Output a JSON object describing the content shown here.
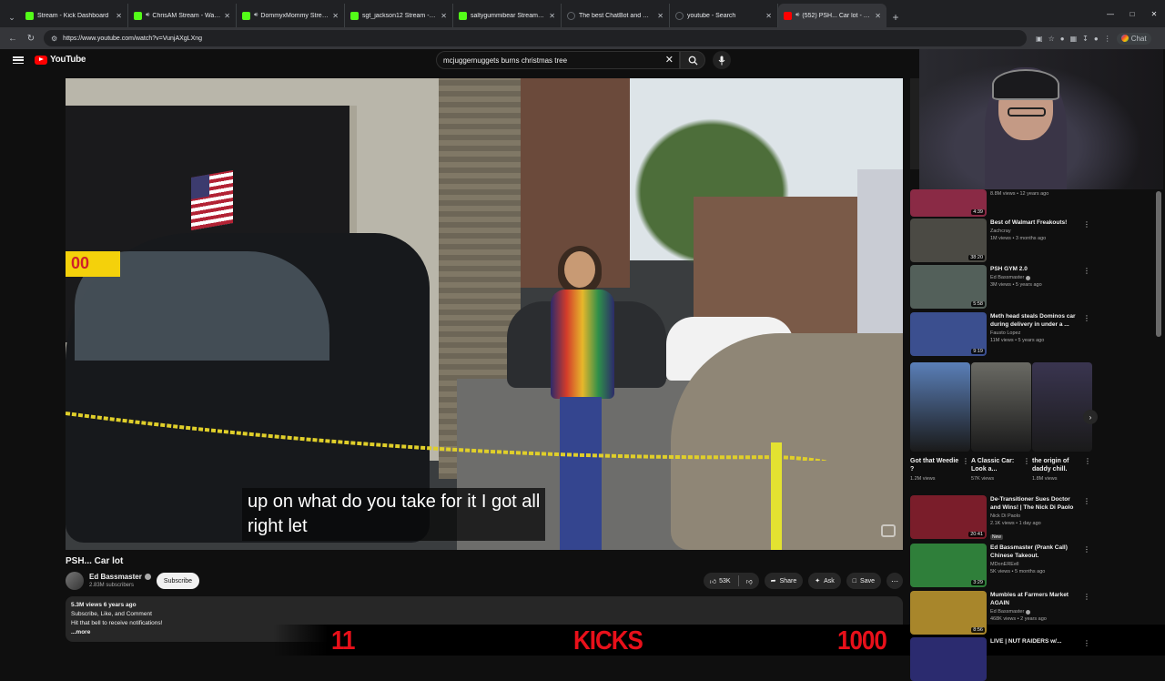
{
  "browser": {
    "tabs": [
      {
        "title": "Stream - Kick Dashboard",
        "favicon": "kick",
        "audio": false,
        "active": false
      },
      {
        "title": "ChrisAM Stream - Watch Live",
        "favicon": "kick",
        "audio": true,
        "active": false
      },
      {
        "title": "DommyxMommy Stream - W...",
        "favicon": "kick",
        "audio": true,
        "active": false
      },
      {
        "title": "sgt_jackson12 Stream - Watch",
        "favicon": "kick",
        "audio": false,
        "active": false
      },
      {
        "title": "saltygummibear Stream - Watch Li...",
        "favicon": "kick",
        "audio": false,
        "active": false
      },
      {
        "title": "The best ChatBot and Widgets for...",
        "favicon": "none",
        "audio": false,
        "active": false
      },
      {
        "title": "youtube - Search",
        "favicon": "none",
        "audio": false,
        "active": false
      },
      {
        "title": "(552) PSH... Car lot - YouTube",
        "favicon": "yt",
        "audio": true,
        "active": true
      }
    ],
    "url": "https://www.youtube.com/watch?v=VunjAXgLXng",
    "chat_label": "Chat"
  },
  "youtube": {
    "logo_text": "YouTube",
    "search_value": "mcjuggernuggets burns christmas tree"
  },
  "video": {
    "caption_line1": "up on what do you take for it I got all",
    "caption_line2": "right let",
    "sticker_text": "00",
    "title": "PSH... Car lot",
    "channel": "Ed Bassmaster",
    "subscribers": "2.83M subscribers",
    "subscribe_label": "Subscribe",
    "likes": "53K",
    "share_label": "Share",
    "ask_label": "Ask",
    "save_label": "Save",
    "views_age": "5.3M views  6 years ago",
    "desc_line1": "Subscribe, Like, and Comment",
    "desc_line2": "Hit that bell to receive notifications!",
    "more_label": "...more"
  },
  "overlay": {
    "left_num": "11",
    "center_text": "KICKS",
    "right_num": "1000",
    "color": "#e8101a"
  },
  "recommendations": [
    {
      "title": "",
      "channel": "",
      "views": "8.8M views • 12 years ago",
      "duration": "4:39",
      "thumb": "#8a2a45"
    },
    {
      "title": "Best of Walmart Freakouts!",
      "channel": "Zachcray",
      "views": "1M views • 3 months ago",
      "duration": "38:20",
      "thumb": "#4b4a44"
    },
    {
      "title": "PSH GYM 2.0",
      "channel": "Ed Bassmaster",
      "verified": true,
      "views": "3M views • 5 years ago",
      "duration": "5:58",
      "thumb": "#53605a"
    },
    {
      "title": "Meth head steals Dominos car during delivery in under a ...",
      "channel": "Fausto Lopez",
      "views": "11M views • 5 years ago",
      "duration": "9:19",
      "thumb": "#3b4f8f"
    },
    {
      "title": "De-Transitioner Sues Doctor and Wins! | The Nick Di Paolo ...",
      "channel": "Nick Di Paolo",
      "views": "2.1K views • 1 day ago",
      "duration": "20:41",
      "new": "New",
      "thumb": "#7a1d2a"
    },
    {
      "title": "Ed Bassmaster (Prank Call) Chinese Takeout.",
      "channel": "MDonEREell",
      "views": "5K views • 5 months ago",
      "duration": "3:29",
      "thumb": "#2f7f3a"
    },
    {
      "title": "Mumbles at Farmers Market AGAIN",
      "channel": "Ed Bassmaster",
      "verified": true,
      "views": "468K views • 2 years ago",
      "duration": "8:56",
      "thumb": "#a8862b"
    },
    {
      "title": "LIVE | NUT RAIDERS w/...",
      "channel": "",
      "views": "",
      "duration": "",
      "thumb": "#2b2b6f"
    }
  ],
  "shorts": [
    {
      "title": "Got that Weedie ?",
      "views": "1.2M views",
      "thumb": "#5a7fb8"
    },
    {
      "title": "A Classic Car: Look a...",
      "views": "57K views",
      "thumb": "#6a6a64"
    },
    {
      "title": "the origin of daddy chill.",
      "views": "1.8M views",
      "thumb": "#3a3550"
    }
  ]
}
